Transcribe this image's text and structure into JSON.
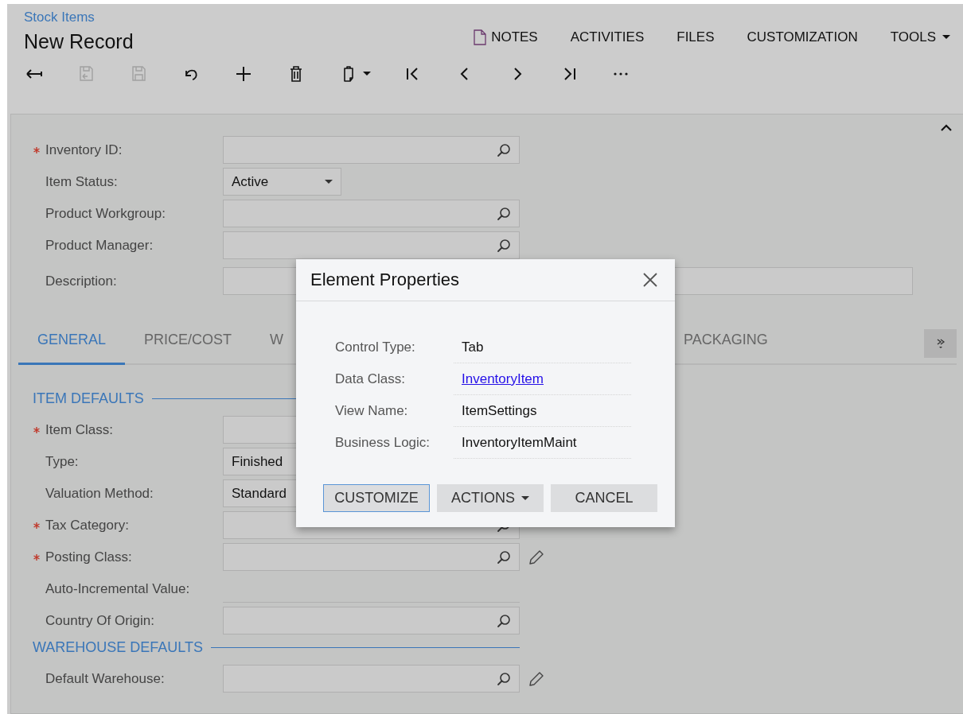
{
  "breadcrumb": "Stock Items",
  "title": "New Record",
  "top_menu": [
    {
      "label": "NOTES",
      "kind": "note"
    },
    {
      "label": "ACTIVITIES",
      "kind": "plain"
    },
    {
      "label": "FILES",
      "kind": "plain"
    },
    {
      "label": "CUSTOMIZATION",
      "kind": "plain"
    },
    {
      "label": "TOOLS",
      "kind": "dropdown"
    }
  ],
  "toolbar": [
    {
      "kind": "back",
      "disabled": false
    },
    {
      "kind": "save-close",
      "disabled": true
    },
    {
      "kind": "save",
      "disabled": true
    },
    {
      "kind": "undo",
      "disabled": false
    },
    {
      "kind": "add",
      "disabled": false
    },
    {
      "kind": "delete",
      "disabled": false
    },
    {
      "kind": "copy",
      "disabled": false
    },
    {
      "kind": "first",
      "disabled": false
    },
    {
      "kind": "prev",
      "disabled": false
    },
    {
      "kind": "next",
      "disabled": false
    },
    {
      "kind": "last",
      "disabled": false
    },
    {
      "kind": "more",
      "disabled": false
    }
  ],
  "summary": {
    "expanded": true,
    "fields": [
      {
        "label": "Inventory ID:",
        "required": true,
        "kind": "lookup"
      },
      {
        "label": "Item Status:",
        "required": false,
        "kind": "select",
        "value": "Active"
      },
      {
        "label": "Product Workgroup:",
        "required": false,
        "kind": "lookup"
      },
      {
        "label": "Product Manager:",
        "required": false,
        "kind": "lookup"
      },
      {
        "label": "Description:",
        "required": false,
        "kind": "wide"
      }
    ]
  },
  "tabs": [
    {
      "label": "GENERAL",
      "selected": true
    },
    {
      "label": "PRICE/COST",
      "selected": false
    },
    {
      "label": "W",
      "selected": false
    },
    {
      "label": "PACKAGING",
      "selected": false
    }
  ],
  "sections": [
    {
      "title": "ITEM DEFAULTS",
      "fields": [
        {
          "label": "Item Class:",
          "required": true,
          "kind": "covered",
          "editable": false
        },
        {
          "label": "Type:",
          "required": false,
          "kind": "covered-select",
          "value": "Finished",
          "editable": false
        },
        {
          "label": "Valuation Method:",
          "required": false,
          "kind": "covered-select",
          "value": "Standard",
          "editable": false
        },
        {
          "label": "Tax Category:",
          "required": true,
          "kind": "lookup",
          "editable": false
        },
        {
          "label": "Posting Class:",
          "required": true,
          "kind": "lookup",
          "editable": true
        },
        {
          "label": "Auto-Incremental Value:",
          "required": false,
          "kind": "readonly",
          "editable": false
        },
        {
          "label": "Country Of Origin:",
          "required": false,
          "kind": "lookup",
          "editable": false
        }
      ]
    },
    {
      "title": "WAREHOUSE DEFAULTS",
      "fields": [
        {
          "label": "Default Warehouse:",
          "required": false,
          "kind": "lookup",
          "editable": true
        }
      ]
    }
  ],
  "dialog": {
    "title": "Element Properties",
    "properties": [
      {
        "label": "Control Type:",
        "value": "Tab",
        "kind": "text"
      },
      {
        "label": "Data Class:",
        "value": "InventoryItem",
        "kind": "link"
      },
      {
        "label": "View Name:",
        "value": "ItemSettings",
        "kind": "text"
      },
      {
        "label": "Business Logic:",
        "value": "InventoryItemMaint",
        "kind": "text"
      }
    ],
    "buttons": [
      {
        "label": "CUSTOMIZE",
        "kind": "plain",
        "focused": true
      },
      {
        "label": "ACTIONS",
        "kind": "dropdown",
        "focused": false
      },
      {
        "label": "CANCEL",
        "kind": "plain",
        "focused": false
      }
    ]
  }
}
